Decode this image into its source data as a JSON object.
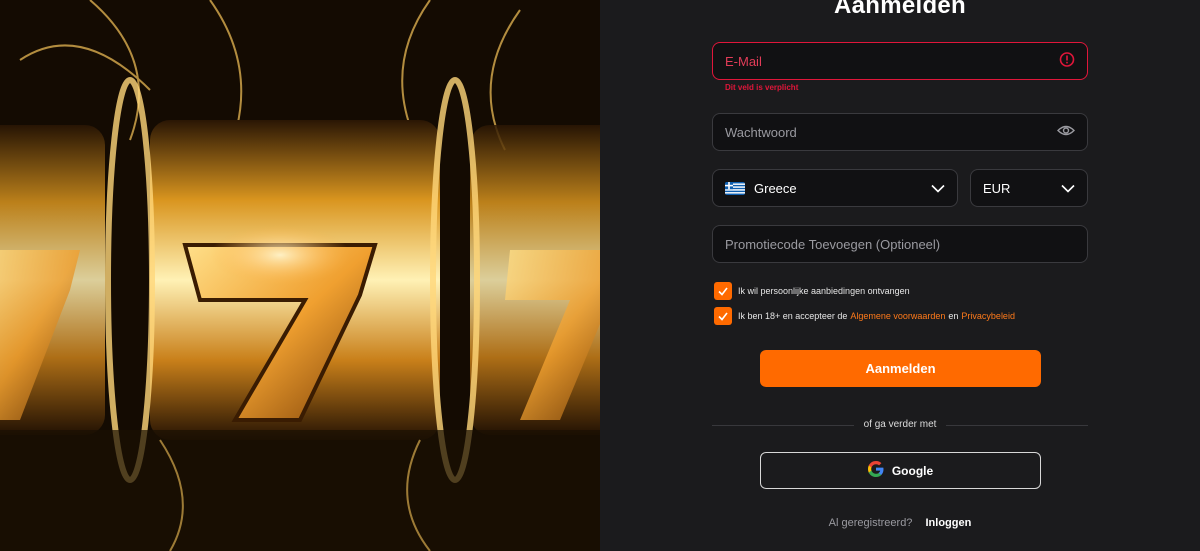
{
  "hero": {
    "alt_icon": "slot-machine-777-illustration"
  },
  "form": {
    "title": "Aanmelden",
    "email": {
      "placeholder": "E-Mail",
      "error": "Dit veld is verplicht"
    },
    "password": {
      "placeholder": "Wachtwoord"
    },
    "country": {
      "value": "Greece"
    },
    "currency": {
      "value": "EUR"
    },
    "promo": {
      "placeholder": "Promotiecode Toevoegen (Optioneel)"
    },
    "checkbox_offers": {
      "label": "Ik wil persoonlijke aanbiedingen ontvangen",
      "checked": true
    },
    "checkbox_terms": {
      "label_prefix": "Ik ben 18+ en accepteer de",
      "terms_link": "Algemene voorwaarden",
      "conjunction": "en",
      "privacy_link": "Privacybeleid",
      "checked": true
    },
    "submit_label": "Aanmelden",
    "divider_text": "of ga verder met",
    "google_label": "Google",
    "already_registered": "Al geregistreerd?",
    "login_link": "Inloggen"
  },
  "colors": {
    "accent": "#ff6a00",
    "error": "#e0163a",
    "background": "#1b1b1d"
  }
}
